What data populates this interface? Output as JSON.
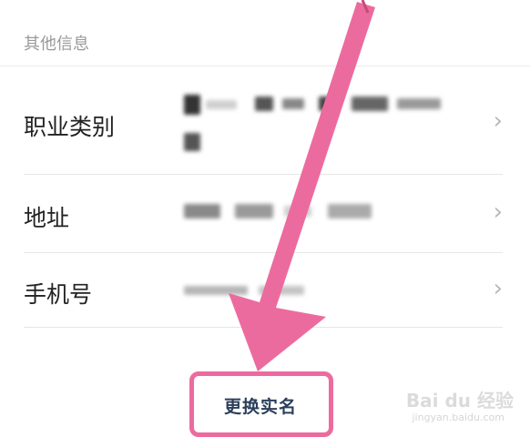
{
  "section_title": "其他信息",
  "rows": [
    {
      "label": "职业类别",
      "chevron": "›"
    },
    {
      "label": "地址",
      "chevron": "›"
    },
    {
      "label": "手机号",
      "chevron": "›"
    }
  ],
  "action_label": "更换实名",
  "watermark": {
    "logo_text": "Bai du 经验",
    "url": "jingyan.baidu.com"
  },
  "colors": {
    "highlight": "#ec6b9f",
    "action_text": "#2b3f5a"
  }
}
